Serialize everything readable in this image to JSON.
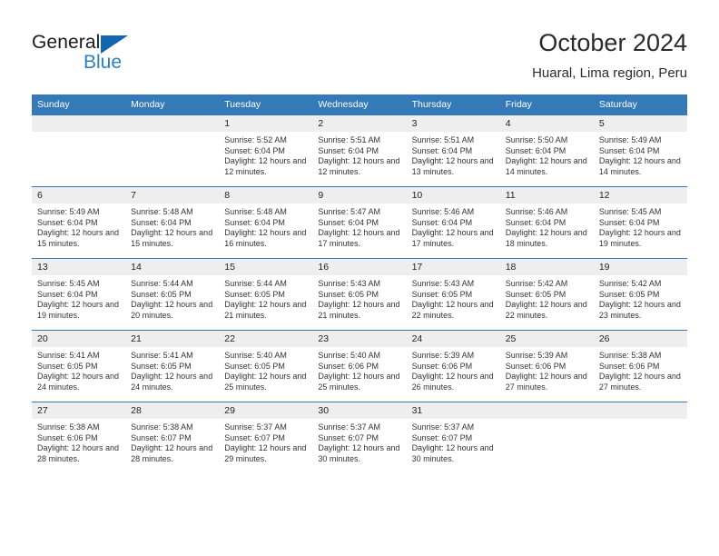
{
  "brand": {
    "name_part1": "General",
    "name_part2": "Blue",
    "logo_icon": "triangle-icon"
  },
  "header": {
    "title": "October 2024",
    "subtitle": "Huaral, Lima region, Peru"
  },
  "calendar": {
    "weekday_headers": [
      "Sunday",
      "Monday",
      "Tuesday",
      "Wednesday",
      "Thursday",
      "Friday",
      "Saturday"
    ],
    "accent_color": "#3479b8",
    "daynum_background": "#eeeeee",
    "weeks": [
      [
        {
          "day": "",
          "empty": true,
          "sunrise": "",
          "sunset": "",
          "daylight": ""
        },
        {
          "day": "",
          "empty": true,
          "sunrise": "",
          "sunset": "",
          "daylight": ""
        },
        {
          "day": "1",
          "empty": false,
          "sunrise": "Sunrise: 5:52 AM",
          "sunset": "Sunset: 6:04 PM",
          "daylight": "Daylight: 12 hours and 12 minutes."
        },
        {
          "day": "2",
          "empty": false,
          "sunrise": "Sunrise: 5:51 AM",
          "sunset": "Sunset: 6:04 PM",
          "daylight": "Daylight: 12 hours and 12 minutes."
        },
        {
          "day": "3",
          "empty": false,
          "sunrise": "Sunrise: 5:51 AM",
          "sunset": "Sunset: 6:04 PM",
          "daylight": "Daylight: 12 hours and 13 minutes."
        },
        {
          "day": "4",
          "empty": false,
          "sunrise": "Sunrise: 5:50 AM",
          "sunset": "Sunset: 6:04 PM",
          "daylight": "Daylight: 12 hours and 14 minutes."
        },
        {
          "day": "5",
          "empty": false,
          "sunrise": "Sunrise: 5:49 AM",
          "sunset": "Sunset: 6:04 PM",
          "daylight": "Daylight: 12 hours and 14 minutes."
        }
      ],
      [
        {
          "day": "6",
          "empty": false,
          "sunrise": "Sunrise: 5:49 AM",
          "sunset": "Sunset: 6:04 PM",
          "daylight": "Daylight: 12 hours and 15 minutes."
        },
        {
          "day": "7",
          "empty": false,
          "sunrise": "Sunrise: 5:48 AM",
          "sunset": "Sunset: 6:04 PM",
          "daylight": "Daylight: 12 hours and 15 minutes."
        },
        {
          "day": "8",
          "empty": false,
          "sunrise": "Sunrise: 5:48 AM",
          "sunset": "Sunset: 6:04 PM",
          "daylight": "Daylight: 12 hours and 16 minutes."
        },
        {
          "day": "9",
          "empty": false,
          "sunrise": "Sunrise: 5:47 AM",
          "sunset": "Sunset: 6:04 PM",
          "daylight": "Daylight: 12 hours and 17 minutes."
        },
        {
          "day": "10",
          "empty": false,
          "sunrise": "Sunrise: 5:46 AM",
          "sunset": "Sunset: 6:04 PM",
          "daylight": "Daylight: 12 hours and 17 minutes."
        },
        {
          "day": "11",
          "empty": false,
          "sunrise": "Sunrise: 5:46 AM",
          "sunset": "Sunset: 6:04 PM",
          "daylight": "Daylight: 12 hours and 18 minutes."
        },
        {
          "day": "12",
          "empty": false,
          "sunrise": "Sunrise: 5:45 AM",
          "sunset": "Sunset: 6:04 PM",
          "daylight": "Daylight: 12 hours and 19 minutes."
        }
      ],
      [
        {
          "day": "13",
          "empty": false,
          "sunrise": "Sunrise: 5:45 AM",
          "sunset": "Sunset: 6:04 PM",
          "daylight": "Daylight: 12 hours and 19 minutes."
        },
        {
          "day": "14",
          "empty": false,
          "sunrise": "Sunrise: 5:44 AM",
          "sunset": "Sunset: 6:05 PM",
          "daylight": "Daylight: 12 hours and 20 minutes."
        },
        {
          "day": "15",
          "empty": false,
          "sunrise": "Sunrise: 5:44 AM",
          "sunset": "Sunset: 6:05 PM",
          "daylight": "Daylight: 12 hours and 21 minutes."
        },
        {
          "day": "16",
          "empty": false,
          "sunrise": "Sunrise: 5:43 AM",
          "sunset": "Sunset: 6:05 PM",
          "daylight": "Daylight: 12 hours and 21 minutes."
        },
        {
          "day": "17",
          "empty": false,
          "sunrise": "Sunrise: 5:43 AM",
          "sunset": "Sunset: 6:05 PM",
          "daylight": "Daylight: 12 hours and 22 minutes."
        },
        {
          "day": "18",
          "empty": false,
          "sunrise": "Sunrise: 5:42 AM",
          "sunset": "Sunset: 6:05 PM",
          "daylight": "Daylight: 12 hours and 22 minutes."
        },
        {
          "day": "19",
          "empty": false,
          "sunrise": "Sunrise: 5:42 AM",
          "sunset": "Sunset: 6:05 PM",
          "daylight": "Daylight: 12 hours and 23 minutes."
        }
      ],
      [
        {
          "day": "20",
          "empty": false,
          "sunrise": "Sunrise: 5:41 AM",
          "sunset": "Sunset: 6:05 PM",
          "daylight": "Daylight: 12 hours and 24 minutes."
        },
        {
          "day": "21",
          "empty": false,
          "sunrise": "Sunrise: 5:41 AM",
          "sunset": "Sunset: 6:05 PM",
          "daylight": "Daylight: 12 hours and 24 minutes."
        },
        {
          "day": "22",
          "empty": false,
          "sunrise": "Sunrise: 5:40 AM",
          "sunset": "Sunset: 6:05 PM",
          "daylight": "Daylight: 12 hours and 25 minutes."
        },
        {
          "day": "23",
          "empty": false,
          "sunrise": "Sunrise: 5:40 AM",
          "sunset": "Sunset: 6:06 PM",
          "daylight": "Daylight: 12 hours and 25 minutes."
        },
        {
          "day": "24",
          "empty": false,
          "sunrise": "Sunrise: 5:39 AM",
          "sunset": "Sunset: 6:06 PM",
          "daylight": "Daylight: 12 hours and 26 minutes."
        },
        {
          "day": "25",
          "empty": false,
          "sunrise": "Sunrise: 5:39 AM",
          "sunset": "Sunset: 6:06 PM",
          "daylight": "Daylight: 12 hours and 27 minutes."
        },
        {
          "day": "26",
          "empty": false,
          "sunrise": "Sunrise: 5:38 AM",
          "sunset": "Sunset: 6:06 PM",
          "daylight": "Daylight: 12 hours and 27 minutes."
        }
      ],
      [
        {
          "day": "27",
          "empty": false,
          "sunrise": "Sunrise: 5:38 AM",
          "sunset": "Sunset: 6:06 PM",
          "daylight": "Daylight: 12 hours and 28 minutes."
        },
        {
          "day": "28",
          "empty": false,
          "sunrise": "Sunrise: 5:38 AM",
          "sunset": "Sunset: 6:07 PM",
          "daylight": "Daylight: 12 hours and 28 minutes."
        },
        {
          "day": "29",
          "empty": false,
          "sunrise": "Sunrise: 5:37 AM",
          "sunset": "Sunset: 6:07 PM",
          "daylight": "Daylight: 12 hours and 29 minutes."
        },
        {
          "day": "30",
          "empty": false,
          "sunrise": "Sunrise: 5:37 AM",
          "sunset": "Sunset: 6:07 PM",
          "daylight": "Daylight: 12 hours and 30 minutes."
        },
        {
          "day": "31",
          "empty": false,
          "sunrise": "Sunrise: 5:37 AM",
          "sunset": "Sunset: 6:07 PM",
          "daylight": "Daylight: 12 hours and 30 minutes."
        },
        {
          "day": "",
          "empty": true,
          "sunrise": "",
          "sunset": "",
          "daylight": ""
        },
        {
          "day": "",
          "empty": true,
          "sunrise": "",
          "sunset": "",
          "daylight": ""
        }
      ]
    ]
  }
}
